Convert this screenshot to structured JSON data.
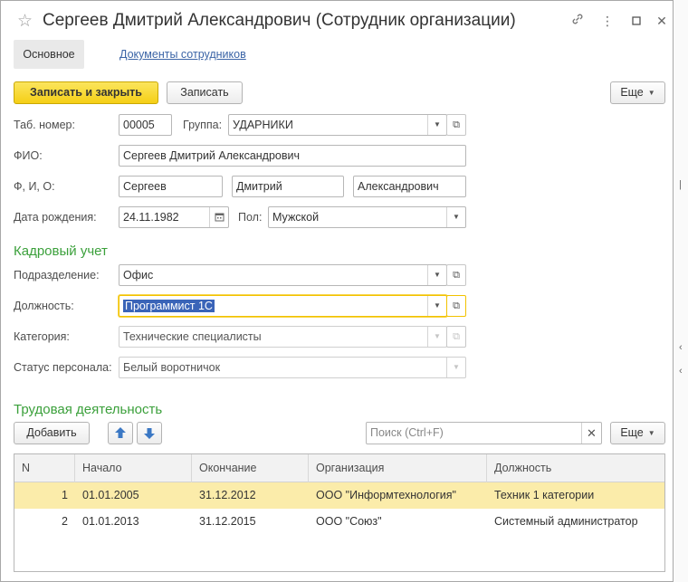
{
  "window": {
    "title": "Сергеев Дмитрий Александрович (Сотрудник организации)"
  },
  "tabs": {
    "main": "Основное",
    "docs": "Документы сотрудников"
  },
  "toolbar": {
    "save_close": "Записать и закрыть",
    "save": "Записать",
    "more": "Еще"
  },
  "fields": {
    "tab_number": {
      "label": "Таб. номер:",
      "value": "00005"
    },
    "group": {
      "label": "Группа:",
      "value": "УДАРНИКИ"
    },
    "fio": {
      "label": "ФИО:",
      "value": "Сергеев Дмитрий Александрович"
    },
    "fio_parts": {
      "label": "Ф, И, О:",
      "last": "Сергеев",
      "first": "Дмитрий",
      "middle": "Александрович"
    },
    "birth": {
      "label": "Дата рождения:",
      "value": "24.11.1982"
    },
    "gender": {
      "label": "Пол:",
      "value": "Мужской"
    }
  },
  "hr": {
    "title": "Кадровый учет",
    "department": {
      "label": "Подразделение:",
      "value": "Офис"
    },
    "position": {
      "label": "Должность:",
      "value": "Программист 1С"
    },
    "category": {
      "label": "Категория:",
      "value": "Технические специалисты"
    },
    "status": {
      "label": "Статус персонала:",
      "value": "Белый воротничок"
    }
  },
  "employment": {
    "title": "Трудовая деятельность",
    "add": "Добавить",
    "search_placeholder": "Поиск (Ctrl+F)",
    "more": "Еще",
    "columns": {
      "n": "N",
      "start": "Начало",
      "end": "Окончание",
      "org": "Организация",
      "position": "Должность"
    },
    "rows": [
      {
        "n": "1",
        "start": "01.01.2005",
        "end": "31.12.2012",
        "org": "ООО \"Информтехнология\"",
        "position": "Техник 1 категории"
      },
      {
        "n": "2",
        "start": "01.01.2013",
        "end": "31.12.2015",
        "org": "ООО \"Союз\"",
        "position": "Системный администратор"
      }
    ]
  },
  "icons": {
    "favorite": "star-icon",
    "link": "link-icon",
    "more": "more-dots-icon",
    "maximize": "maximize-icon",
    "close": "close-icon",
    "calendar": "calendar-icon",
    "open": "open-form-icon",
    "up": "arrow-up-icon",
    "down": "arrow-down-icon"
  },
  "colors": {
    "primary_button": "#f5cf16",
    "section_title": "#3ba03b",
    "link": "#3b64a6",
    "selected_row": "#fbecaa",
    "focus_border": "#f2c200"
  }
}
